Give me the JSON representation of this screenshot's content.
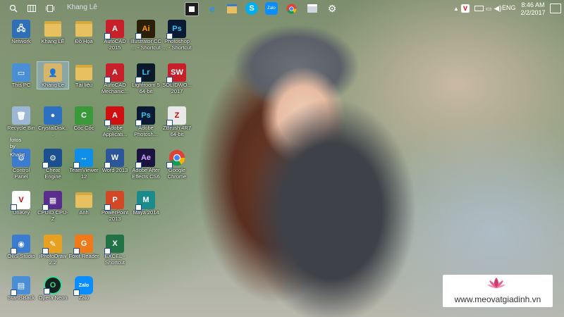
{
  "topbar": {
    "user": "Khang Lê",
    "tray_lang": "ENG",
    "clock_time": "8:46 AM",
    "clock_date": "2/2/2017",
    "pinned": [
      "folder-icon",
      "edge-icon",
      "file-explorer-icon",
      "skype-icon",
      "zalo-icon",
      "chrome-icon",
      "printer-icon",
      "settings-icon"
    ]
  },
  "icons": [
    {
      "label": "Network",
      "icon": "network-icon",
      "color": "#2f6fb8",
      "glyph": "🖧"
    },
    {
      "label": "Khang LÊ",
      "icon": "folder-icon",
      "color": "#e8c060",
      "glyph": ""
    },
    {
      "label": "Đồ Họa",
      "icon": "folder-icon",
      "color": "#e8c060",
      "glyph": ""
    },
    {
      "label": "AutoCAD 2015",
      "icon": "autocad-icon",
      "color": "#c8202a",
      "glyph": "A"
    },
    {
      "label": "Illustrator CC ... - Shortcut",
      "icon": "illustrator-icon",
      "color": "#2b1f05",
      "glyph": "Ai"
    },
    {
      "label": "Photoshop ... - Shortcut",
      "icon": "photoshop-icon",
      "color": "#0a1a33",
      "glyph": "Ps"
    },
    {
      "label": "This PC",
      "icon": "computer-icon",
      "color": "#4a8fd6",
      "glyph": "▭"
    },
    {
      "label": "Khang Le",
      "icon": "user-folder-icon",
      "color": "#d9b56a",
      "glyph": "👤"
    },
    {
      "label": "Tài liệu",
      "icon": "folder-icon",
      "color": "#e8c060",
      "glyph": ""
    },
    {
      "label": "AutoCAD Mechanic...",
      "icon": "autocad-mechanical-icon",
      "color": "#c8202a",
      "glyph": "A"
    },
    {
      "label": "Lightroom 5 64-bit",
      "icon": "lightroom-icon",
      "color": "#0b1a2a",
      "glyph": "Lr"
    },
    {
      "label": "SOLIDWO... 2017",
      "icon": "solidworks-icon",
      "color": "#c8202a",
      "glyph": "SW"
    },
    {
      "label": "Recycle Bin",
      "icon": "recycle-bin-icon",
      "color": "#9bb7d4",
      "glyph": "🗑"
    },
    {
      "label": "CrystalDisk...",
      "icon": "crystaldisk-icon",
      "color": "#2d6fc0",
      "glyph": "●"
    },
    {
      "label": "Cốc Cốc",
      "icon": "coccoc-icon",
      "color": "#3a9a3a",
      "glyph": "C"
    },
    {
      "label": "Adobe Applicati...",
      "icon": "adobe-icon",
      "color": "#d01010",
      "glyph": "A"
    },
    {
      "label": "Adobe Photosh...",
      "icon": "photoshop-icon",
      "color": "#0a1a33",
      "glyph": "Ps"
    },
    {
      "label": "ZBrush 4R7 64-bit",
      "icon": "zbrush-icon",
      "color": "#e8e8e8",
      "glyph": "Z"
    },
    {
      "label": "Control Panel",
      "icon": "control-panel-icon",
      "color": "#3b7bd0",
      "glyph": "⚙"
    },
    {
      "label": "Cheat Engine",
      "icon": "cheat-engine-icon",
      "color": "#1c4f8f",
      "glyph": "⚙"
    },
    {
      "label": "TeamViewer 12",
      "icon": "teamviewer-icon",
      "color": "#0e8ee9",
      "glyph": "↔"
    },
    {
      "label": "Word 2013",
      "icon": "word-icon",
      "color": "#2b579a",
      "glyph": "W"
    },
    {
      "label": "Adobe After Effects CS6",
      "icon": "after-effects-icon",
      "color": "#1b1240",
      "glyph": "Ae"
    },
    {
      "label": "Google Chrome",
      "icon": "chrome-icon",
      "color": "#ffffff",
      "glyph": ""
    },
    {
      "label": "UniKey",
      "icon": "unikey-icon",
      "color": "#ffffff",
      "glyph": "V"
    },
    {
      "label": "CPUID CPU-Z",
      "icon": "cpuz-icon",
      "color": "#5a2d8c",
      "glyph": "▦"
    },
    {
      "label": "Anh",
      "icon": "folder-icon",
      "color": "#e8c060",
      "glyph": ""
    },
    {
      "label": "PowerPoint 2013",
      "icon": "powerpoint-icon",
      "color": "#d24726",
      "glyph": "P"
    },
    {
      "label": "Maya 2014",
      "icon": "maya-icon",
      "color": "#1a8a8a",
      "glyph": "M"
    },
    {
      "label": "OBS Studio",
      "icon": "obs-icon",
      "color": "#3b7bd0",
      "glyph": "◉"
    },
    {
      "label": "iPhotoDraw 2.2",
      "icon": "iphotodraw-icon",
      "color": "#e8a020",
      "glyph": "✎"
    },
    {
      "label": "Foxit Reader",
      "icon": "foxit-icon",
      "color": "#f07a1a",
      "glyph": "G"
    },
    {
      "label": "EXCEL - Shortcut",
      "icon": "excel-icon",
      "color": "#217346",
      "glyph": "X"
    },
    {
      "label": "StartIsBack",
      "icon": "startisback-icon",
      "color": "#4a8fd6",
      "glyph": "▤"
    },
    {
      "label": "Opera Neon",
      "icon": "opera-neon-icon",
      "color": "#13221c",
      "glyph": "O"
    },
    {
      "label": "Zalo",
      "icon": "zalo-icon",
      "color": "#0a8dff",
      "glyph": "Zalo"
    }
  ],
  "stray_text": [
    "fotos",
    "by",
    "Khalat",
    "Control"
  ],
  "watermark": {
    "site": "www.meovatgiadinh.vn",
    "accent": "#d9366f"
  }
}
